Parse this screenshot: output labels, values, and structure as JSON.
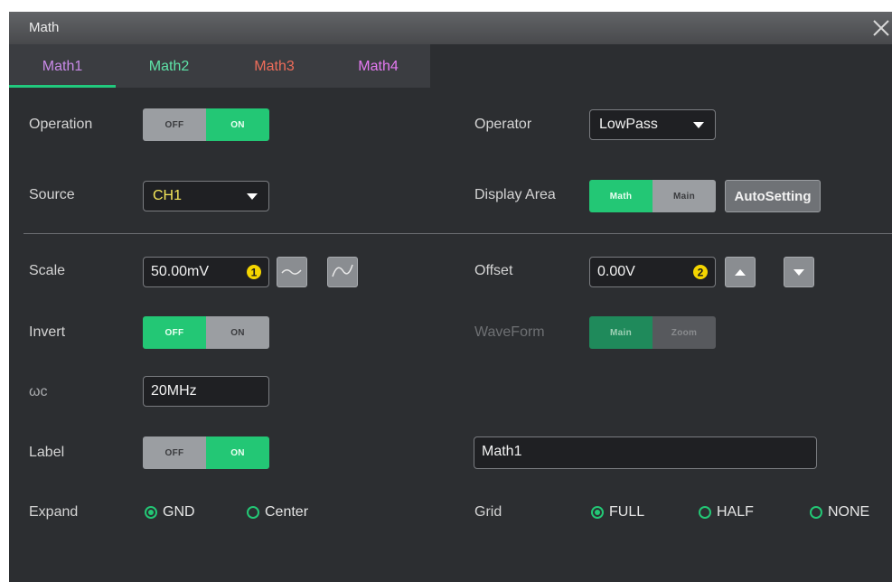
{
  "window": {
    "title": "Math"
  },
  "colors": {
    "accent": "#23c775",
    "badge": "#f4d500"
  },
  "tabs": [
    {
      "label": "Math1",
      "color": "#c98ae8",
      "active": true
    },
    {
      "label": "Math2",
      "color": "#5ee3a8",
      "active": false
    },
    {
      "label": "Math3",
      "color": "#ef6d5a",
      "active": false
    },
    {
      "label": "Math4",
      "color": "#e57af2",
      "active": false
    }
  ],
  "operation": {
    "label": "Operation",
    "off": "OFF",
    "on": "ON",
    "value": "ON"
  },
  "operator": {
    "label": "Operator",
    "value": "LowPass"
  },
  "source": {
    "label": "Source",
    "value": "CH1"
  },
  "display_area": {
    "label": "Display Area",
    "math": "Math",
    "main": "Main",
    "value": "Math",
    "autosetting": "AutoSetting"
  },
  "scale": {
    "label": "Scale",
    "value": "50.00mV",
    "badge": "1"
  },
  "offset": {
    "label": "Offset",
    "value": "0.00V",
    "badge": "2"
  },
  "invert": {
    "label": "Invert",
    "off": "OFF",
    "on": "ON",
    "value": "OFF"
  },
  "waveform": {
    "label": "WaveForm",
    "main": "Main",
    "zoom": "Zoom",
    "value": "Main"
  },
  "wc": {
    "label": "ωc",
    "value": "20MHz"
  },
  "label_row": {
    "label": "Label",
    "off": "OFF",
    "on": "ON",
    "value": "ON",
    "text": "Math1"
  },
  "expand": {
    "label": "Expand",
    "options": [
      "GND",
      "Center"
    ],
    "value": "GND"
  },
  "grid": {
    "label": "Grid",
    "options": [
      "FULL",
      "HALF",
      "NONE"
    ],
    "value": "FULL"
  }
}
